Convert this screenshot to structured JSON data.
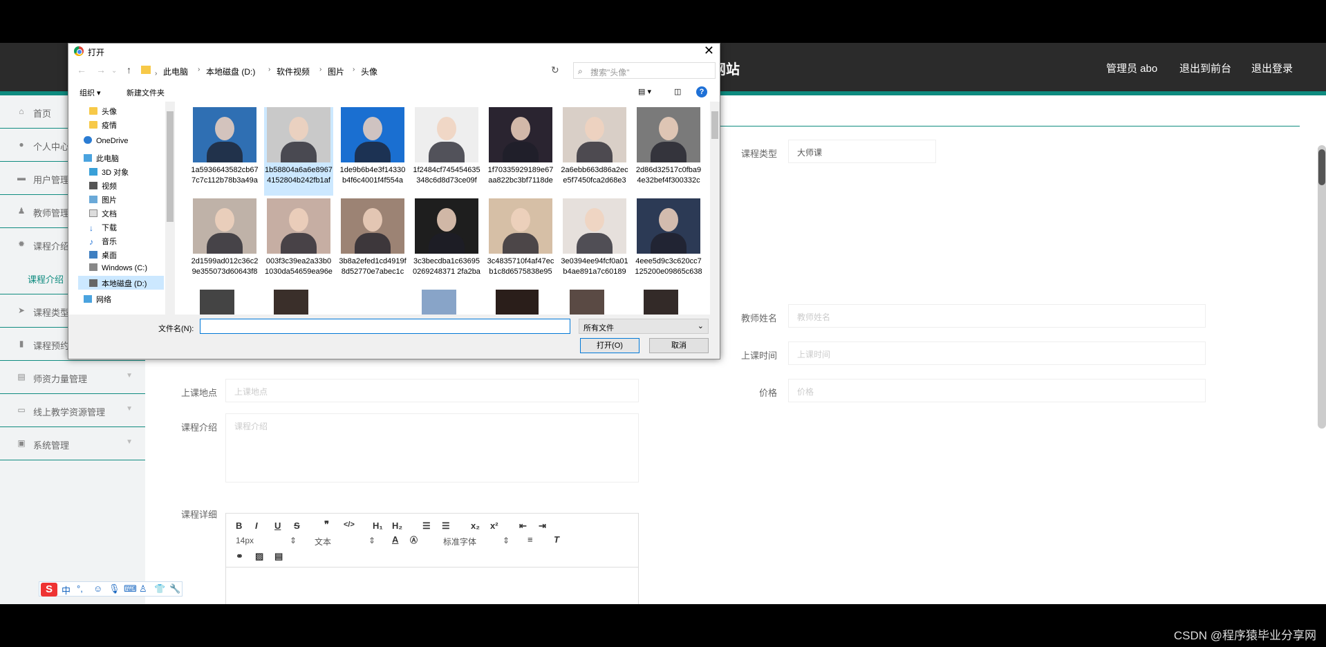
{
  "header": {
    "site_title_fragment": "网站",
    "nav": [
      "管理员 abo",
      "退出到前台",
      "退出登录"
    ]
  },
  "sidebar": {
    "items": [
      {
        "label": "首页",
        "icon": "home-icon"
      },
      {
        "label": "个人中心",
        "icon": "user-icon"
      },
      {
        "label": "用户管理",
        "icon": "monitor-icon"
      },
      {
        "label": "教师管理",
        "icon": "person-icon"
      },
      {
        "label": "课程介绍",
        "icon": "gear-icon"
      },
      {
        "label": "课程类型",
        "icon": "send-icon"
      },
      {
        "label": "课程预约",
        "icon": "bar-chart-icon"
      },
      {
        "label": "师资力量管理",
        "icon": "list-icon"
      },
      {
        "label": "线上教学资源管理",
        "icon": "window-icon"
      },
      {
        "label": "系统管理",
        "icon": "settings-window-icon"
      }
    ],
    "sub_item": "课程介绍"
  },
  "form": {
    "course_type_label": "课程类型",
    "course_type_value": "大师课",
    "teacher_name_label": "教师姓名",
    "teacher_name_placeholder": "教师姓名",
    "class_time_label": "上课时间",
    "class_time_placeholder": "上课时间",
    "location_label": "上课地点",
    "location_placeholder": "上课地点",
    "price_label": "价格",
    "price_placeholder": "价格",
    "intro_label": "课程介绍",
    "intro_placeholder": "课程介绍",
    "detail_label": "课程详细"
  },
  "editor": {
    "font_size": "14px",
    "paragraph": "文本",
    "font_family": "标准字体"
  },
  "dialog": {
    "title": "打开",
    "breadcrumbs": [
      "此电脑",
      "本地磁盘 (D:)",
      "软件视频",
      "图片",
      "头像"
    ],
    "search_placeholder": "搜索\"头像\"",
    "organize": "组织 ▾",
    "new_folder": "新建文件夹",
    "nav_items": [
      "头像",
      "疫情",
      "OneDrive",
      "此电脑",
      "3D 对象",
      "视频",
      "图片",
      "文档",
      "下载",
      "音乐",
      "桌面",
      "Windows (C:)",
      "本地磁盘 (D:)",
      "网络"
    ],
    "files": [
      {
        "name": "1a5936643582cb677c7c112b78b3a49a",
        "color": "#2f6fb3"
      },
      {
        "name": "1b58804a6a6e89674152804b242fb1af",
        "color": "#c9c9c9"
      },
      {
        "name": "1de9b6b4e3f14330b4f6c4001f4f554a",
        "color": "#1a6fd1"
      },
      {
        "name": "1f2484cf745454635348c6d8d73ce09f",
        "color": "#eeeeee"
      },
      {
        "name": "1f70335929189e67aa822bc3bf7118de",
        "color": "#2a2430"
      },
      {
        "name": "2a6ebb663d86a2ece5f7450fca2d68e3",
        "color": "#d9cfc7"
      },
      {
        "name": "2d86d32517c0fba94e32bef4f300332c",
        "color": "#7a7a7a"
      },
      {
        "name": "2d1599ad012c36c29e355073d60643f8",
        "color": "#bfb2a8"
      },
      {
        "name": "003f3c39ea2a33b01030da54659ea96e",
        "color": "#c6aea3"
      },
      {
        "name": "3b8a2efed1cd4919f8d52770e7abec1c",
        "color": "#9c8374"
      },
      {
        "name": "3c3becdba1c636950269248371 2fa2ba",
        "color": "#1e1e1e"
      },
      {
        "name": "3c4835710f4af47ecb1c8d6575838e95",
        "color": "#d6bfa6"
      },
      {
        "name": "3e0394ee94fcf0a01b4ae891a7c60189",
        "color": "#e6e0dc"
      },
      {
        "name": "4eee5d9c3c620cc7125200e09865c638",
        "color": "#2c3a55"
      }
    ],
    "filename_label": "文件名(N):",
    "filename_value": "",
    "file_type": "所有文件",
    "open_button": "打开(O)",
    "cancel_button": "取消"
  },
  "ime": {
    "label": "中"
  },
  "watermark": "CSDN @程序猿毕业分享网"
}
